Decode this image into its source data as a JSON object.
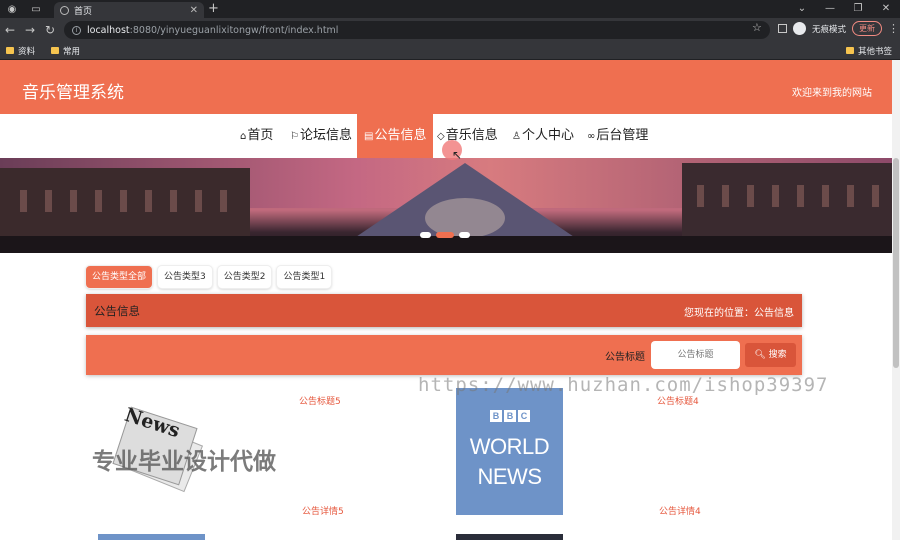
{
  "browser": {
    "tab_title": "首页",
    "address_host": "localhost",
    "address_path": ":8080/yinyueguanlixitongw/front/index.html",
    "incognito_label": "无痕模式",
    "update_label": "更新",
    "bookmarks": [
      "资料",
      "常用"
    ],
    "other_bookmarks": "其他书签"
  },
  "site": {
    "title": "音乐管理系统",
    "welcome": "欢迎来到我的网站"
  },
  "nav": {
    "items": [
      {
        "label": "首页",
        "icon": "home-icon",
        "glyph": "⌂"
      },
      {
        "label": "论坛信息",
        "icon": "flag-icon",
        "glyph": "⚐"
      },
      {
        "label": "公告信息",
        "icon": "notice-icon",
        "glyph": "▤",
        "active": true
      },
      {
        "label": "音乐信息",
        "icon": "tag-icon",
        "glyph": "◇"
      },
      {
        "label": "个人中心",
        "icon": "user-icon",
        "glyph": "♙"
      },
      {
        "label": "后台管理",
        "icon": "link-icon",
        "glyph": "∞"
      }
    ]
  },
  "carousel": {
    "slide_count": 3,
    "active_index": 1
  },
  "filters": {
    "chips": [
      "公告类型全部",
      "公告类型3",
      "公告类型2",
      "公告类型1"
    ],
    "active_index": 0
  },
  "section": {
    "title": "公告信息",
    "breadcrumb": "您现在的位置：公告信息"
  },
  "search": {
    "label": "公告标题",
    "placeholder": "公告标题",
    "button_label": "搜索",
    "button_icon": "search-icon"
  },
  "cards": [
    {
      "title": "公告标题5",
      "detail": "公告详情5",
      "image": "newspaper"
    },
    {
      "title": "公告标题4",
      "detail": "公告详情4",
      "image": "bbc-world-news"
    }
  ],
  "thumbnails": {
    "paper_text": "News",
    "bbc_letters": [
      "B",
      "B",
      "C"
    ],
    "bbc_lines": [
      "WORLD",
      "NEWS"
    ]
  },
  "watermarks": {
    "url": "https://www.huzhan.com/ishop39397",
    "text": "专业毕业设计代做"
  },
  "colors": {
    "primary": "#ef6f50",
    "primary_dark": "#d9553a",
    "link": "#e6573c"
  }
}
